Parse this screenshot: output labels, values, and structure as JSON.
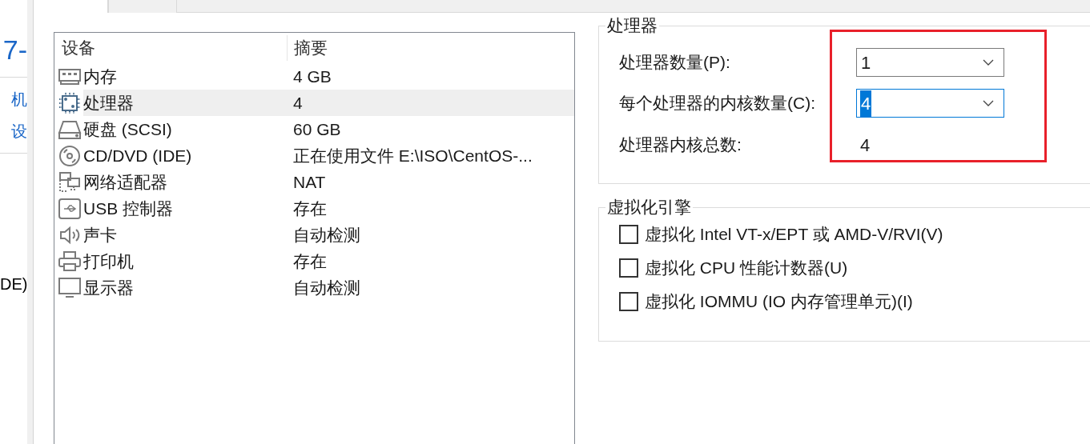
{
  "background_window": {
    "texts": [
      {
        "kind": "heading",
        "text": "7-"
      },
      {
        "kind": "divider"
      },
      {
        "kind": "link",
        "text": "机"
      },
      {
        "kind": "link",
        "text": "设"
      },
      {
        "kind": "divider"
      },
      {
        "kind": "plain",
        "text": "DE)"
      }
    ]
  },
  "tabs": [
    {
      "selected": true
    },
    {
      "selected": false
    }
  ],
  "device_table": {
    "columns": [
      "设备",
      "摘要"
    ],
    "rows": [
      {
        "kind": "memory",
        "device": "内存",
        "summary": "4 GB",
        "selected": false
      },
      {
        "kind": "cpu",
        "device": "处理器",
        "summary": "4",
        "selected": true
      },
      {
        "kind": "disk",
        "device": "硬盘 (SCSI)",
        "summary": "60 GB",
        "selected": false
      },
      {
        "kind": "cd",
        "device": "CD/DVD (IDE)",
        "summary": "正在使用文件 E:\\ISO\\CentOS-...",
        "selected": false
      },
      {
        "kind": "network",
        "device": "网络适配器",
        "summary": "NAT",
        "selected": false
      },
      {
        "kind": "usb",
        "device": "USB 控制器",
        "summary": "存在",
        "selected": false
      },
      {
        "kind": "sound",
        "device": "声卡",
        "summary": "自动检测",
        "selected": false
      },
      {
        "kind": "printer",
        "device": "打印机",
        "summary": "存在",
        "selected": false
      },
      {
        "kind": "display",
        "device": "显示器",
        "summary": "自动检测",
        "selected": false
      }
    ]
  },
  "processor_group": {
    "title": "处理器",
    "fields": [
      {
        "label": "处理器数量(P):",
        "value": "1",
        "focused": false
      },
      {
        "label": "每个处理器的内核数量(C):",
        "value": "4",
        "focused": true
      }
    ],
    "total": {
      "label": "处理器内核总数:",
      "value": "4"
    }
  },
  "virtualization_group": {
    "title": "虚拟化引擎",
    "options": [
      {
        "label": "虚拟化 Intel VT-x/EPT 或 AMD-V/RVI(V)",
        "checked": false
      },
      {
        "label": "虚拟化 CPU 性能计数器(U)",
        "checked": false
      },
      {
        "label": "虚拟化 IOMMU (IO 内存管理单元)(I)",
        "checked": false
      }
    ]
  }
}
